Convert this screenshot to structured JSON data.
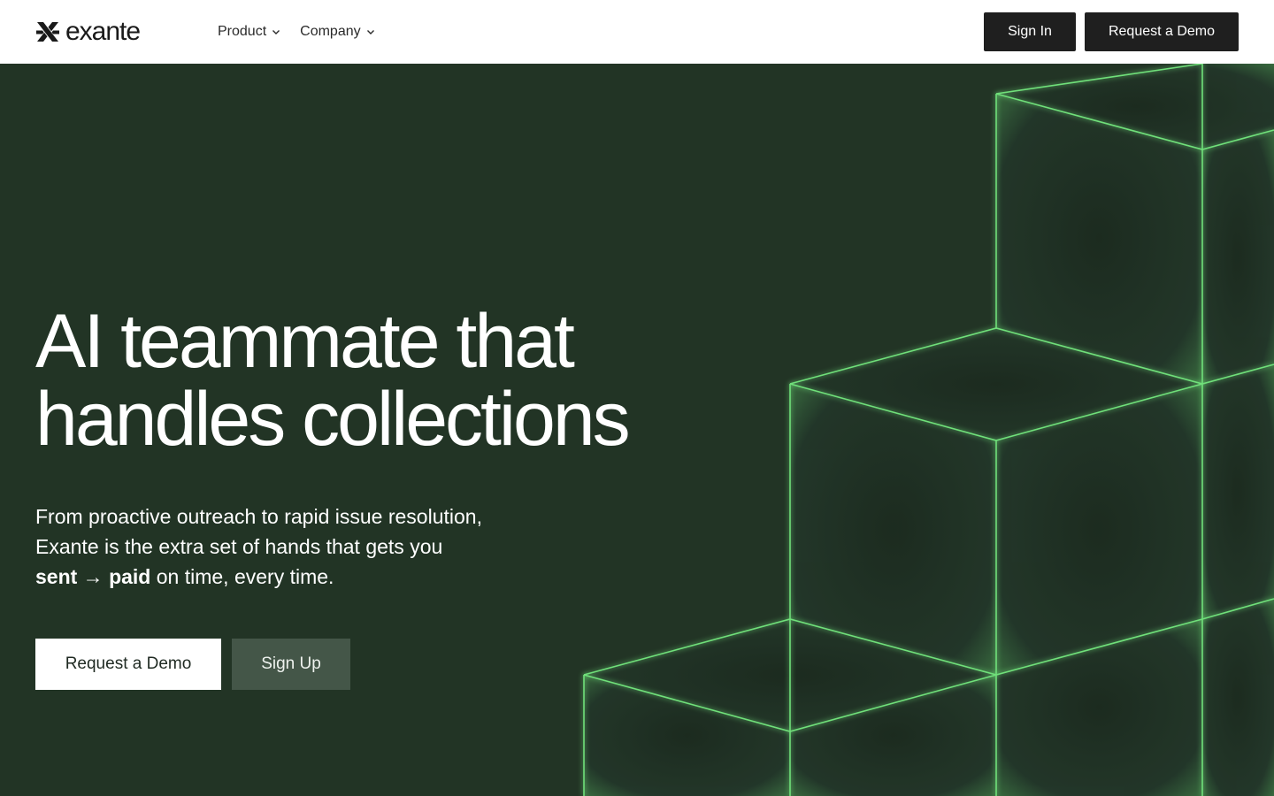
{
  "brand": {
    "name": "exante"
  },
  "nav": {
    "menu": [
      {
        "label": "Product"
      },
      {
        "label": "Company"
      }
    ],
    "sign_in": "Sign In",
    "request_demo": "Request a Demo"
  },
  "hero": {
    "headline_line1": "AI teammate that",
    "headline_line2": "handles collections",
    "sub_part1": "From proactive outreach to rapid issue resolution, Exante is the extra set of hands that gets you ",
    "sub_bold": "sent → paid",
    "sub_part2": " on time, every time.",
    "cta_primary": "Request a Demo",
    "cta_secondary": "Sign Up"
  },
  "colors": {
    "nav_bg": "#ffffff",
    "hero_bg": "#223425",
    "cube_edge": "#6fe07a",
    "dark_button": "#1f1f1f",
    "secondary_button": "#445648"
  },
  "icons": [
    "exante-logo-icon",
    "chevron-down-icon"
  ]
}
